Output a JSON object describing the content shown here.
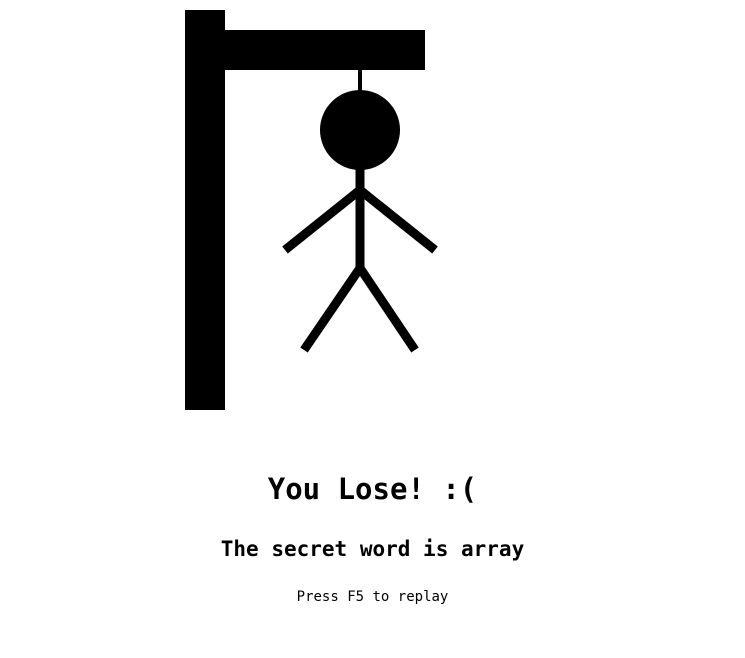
{
  "game": {
    "result_text": "You Lose! :(",
    "secret_prefix": "The secret word is",
    "secret_word": "array",
    "replay_hint": "Press F5 to replay"
  },
  "hangman": {
    "parts_drawn": [
      "head",
      "body",
      "left-arm",
      "right-arm",
      "left-leg",
      "right-leg"
    ],
    "color": "#000000"
  }
}
